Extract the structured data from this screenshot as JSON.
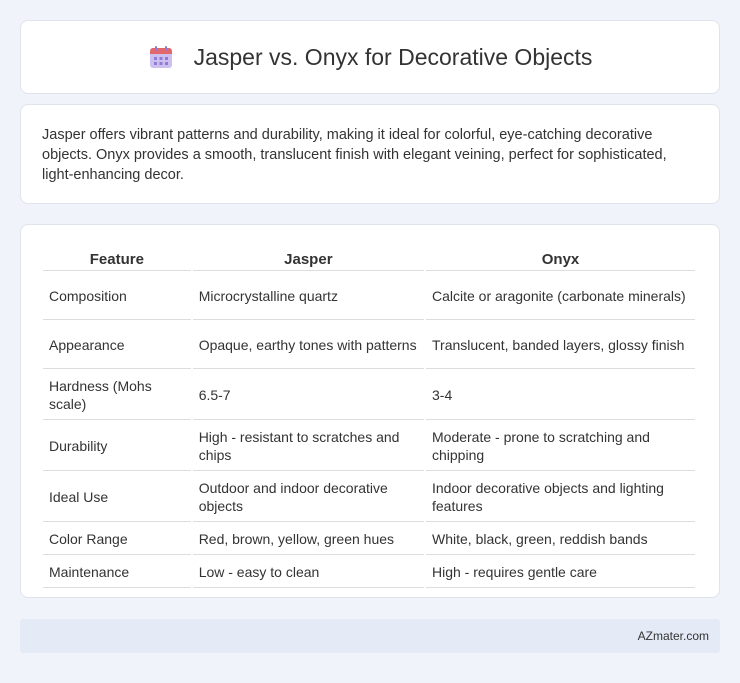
{
  "header": {
    "title": "Jasper vs. Onyx for Decorative Objects",
    "icon": "calendar-icon",
    "icon_colors": {
      "top": "#e2686d",
      "body": "#b8a6e6",
      "dots": "#8e7bd6"
    }
  },
  "intro": {
    "text": "Jasper offers vibrant patterns and durability, making it ideal for colorful, eye-catching decorative objects. Onyx provides a smooth, translucent finish with elegant veining, perfect for sophisticated, light-enhancing decor."
  },
  "table": {
    "headers": [
      "Feature",
      "Jasper",
      "Onyx"
    ],
    "rows": [
      [
        "Composition",
        "Microcrystalline quartz",
        "Calcite or aragonite (carbonate minerals)"
      ],
      [
        "Appearance",
        "Opaque, earthy tones with patterns",
        "Translucent, banded layers, glossy finish"
      ],
      [
        "Hardness (Mohs scale)",
        "6.5-7",
        "3-4"
      ],
      [
        "Durability",
        "High - resistant to scratches and chips",
        "Moderate - prone to scratching and chipping"
      ],
      [
        "Ideal Use",
        "Outdoor and indoor decorative objects",
        "Indoor decorative objects and lighting features"
      ],
      [
        "Color Range",
        "Red, brown, yellow, green hues",
        "White, black, green, reddish bands"
      ],
      [
        "Maintenance",
        "Low - easy to clean",
        "High - requires gentle care"
      ]
    ]
  },
  "footer": {
    "text": "AZmater.com"
  }
}
